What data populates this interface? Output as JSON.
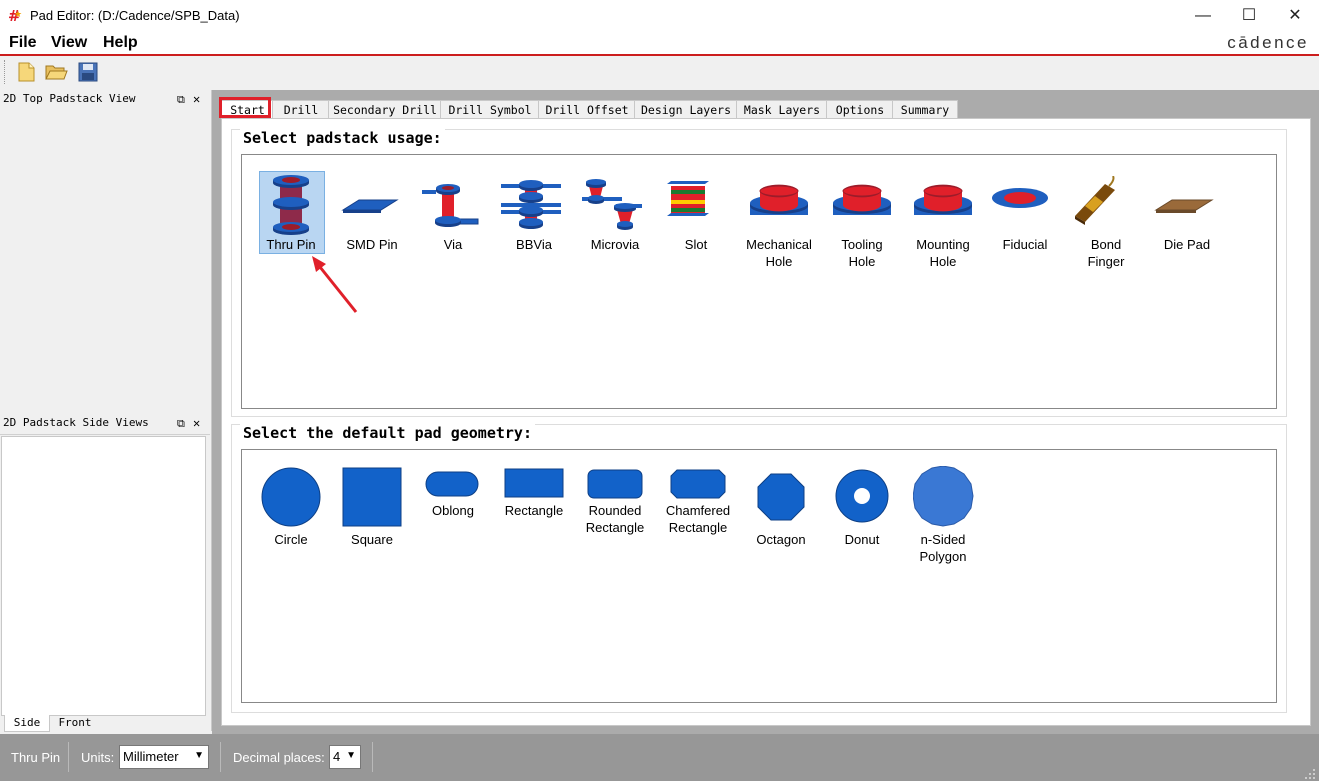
{
  "window": {
    "title": "Pad Editor:   (D:/Cadence/SPB_Data)",
    "controls": {
      "minimize": "—",
      "maximize": "☐",
      "close": "✕"
    }
  },
  "menu": {
    "file": "File",
    "view": "View",
    "help": "Help",
    "logo": "cādence"
  },
  "toolbar": {
    "icons": [
      "new-file-icon",
      "open-folder-icon",
      "save-icon"
    ]
  },
  "left_panels": {
    "top_view_title": "2D Top Padstack View",
    "side_views_title": "2D Padstack Side Views",
    "bottom_tabs": [
      "Side",
      "Front"
    ]
  },
  "tabs": [
    "Start",
    "Drill",
    "Secondary Drill",
    "Drill Symbol",
    "Drill Offset",
    "Design Layers",
    "Mask Layers",
    "Options",
    "Summary"
  ],
  "active_tab": "Start",
  "usage": {
    "title": "Select padstack usage:",
    "items": [
      {
        "label": "Thru Pin",
        "icon": "thru-pin-icon",
        "selected": true
      },
      {
        "label": "SMD Pin",
        "icon": "smd-pin-icon"
      },
      {
        "label": "Via",
        "icon": "via-icon"
      },
      {
        "label": "BBVia",
        "icon": "bbvia-icon"
      },
      {
        "label": "Microvia",
        "icon": "microvia-icon"
      },
      {
        "label": "Slot",
        "icon": "slot-icon"
      },
      {
        "label": "Mechanical\nHole",
        "icon": "mechanical-hole-icon"
      },
      {
        "label": "Tooling\nHole",
        "icon": "tooling-hole-icon"
      },
      {
        "label": "Mounting\nHole",
        "icon": "mounting-hole-icon"
      },
      {
        "label": "Fiducial",
        "icon": "fiducial-icon"
      },
      {
        "label": "Bond\nFinger",
        "icon": "bond-finger-icon"
      },
      {
        "label": "Die Pad",
        "icon": "die-pad-icon"
      }
    ]
  },
  "geometry": {
    "title": "Select the default pad geometry:",
    "items": [
      {
        "label": "Circle",
        "icon": "circle-icon"
      },
      {
        "label": "Square",
        "icon": "square-icon"
      },
      {
        "label": "Oblong",
        "icon": "oblong-icon"
      },
      {
        "label": "Rectangle",
        "icon": "rectangle-icon"
      },
      {
        "label": "Rounded\nRectangle",
        "icon": "rounded-rectangle-icon"
      },
      {
        "label": "Chamfered\nRectangle",
        "icon": "chamfered-rectangle-icon"
      },
      {
        "label": "Octagon",
        "icon": "octagon-icon"
      },
      {
        "label": "Donut",
        "icon": "donut-icon"
      },
      {
        "label": "n-Sided\nPolygon",
        "icon": "n-sided-polygon-icon"
      }
    ]
  },
  "status": {
    "usage": "Thru Pin",
    "units_label": "Units:",
    "units_value": "Millimeter",
    "decimal_label": "Decimal places:",
    "decimal_value": "4"
  },
  "colors": {
    "accent_red": "#e0202a",
    "pad_blue": "#1560c8",
    "barrel_red": "#a02040"
  }
}
